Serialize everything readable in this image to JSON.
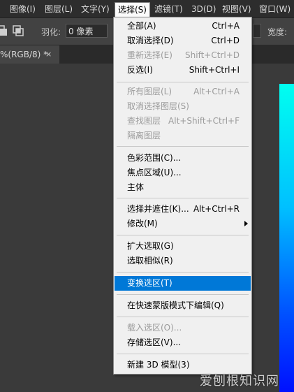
{
  "menubar": {
    "items": [
      "图像(I)",
      "图层(L)",
      "文字(Y)",
      "选择(S)",
      "滤镜(T)",
      "3D(D)",
      "视图(V)",
      "窗口(W)"
    ]
  },
  "options": {
    "feather_label": "羽化:",
    "feather_value": "0 像素",
    "width_label": "宽度:"
  },
  "document_tab": {
    "title": "%(RGB/8) *",
    "close": "×"
  },
  "select_menu": {
    "items": [
      {
        "label": "全部(A)",
        "shortcut": "Ctrl+A",
        "enabled": true
      },
      {
        "label": "取消选择(D)",
        "shortcut": "Ctrl+D",
        "enabled": true
      },
      {
        "label": "重新选择(E)",
        "shortcut": "Shift+Ctrl+D",
        "enabled": false
      },
      {
        "label": "反选(I)",
        "shortcut": "Shift+Ctrl+I",
        "enabled": true
      },
      {
        "label": "所有图层(L)",
        "shortcut": "Alt+Ctrl+A",
        "enabled": false
      },
      {
        "label": "取消选择图层(S)",
        "shortcut": "",
        "enabled": false
      },
      {
        "label": "查找图层",
        "shortcut": "Alt+Shift+Ctrl+F",
        "enabled": false
      },
      {
        "label": "隔离图层",
        "shortcut": "",
        "enabled": false
      },
      {
        "label": "色彩范围(C)...",
        "shortcut": "",
        "enabled": true
      },
      {
        "label": "焦点区域(U)...",
        "shortcut": "",
        "enabled": true
      },
      {
        "label": "主体",
        "shortcut": "",
        "enabled": true
      },
      {
        "label": "选择并遮住(K)...",
        "shortcut": "Alt+Ctrl+R",
        "enabled": true
      },
      {
        "label": "修改(M)",
        "shortcut": "",
        "enabled": true,
        "submenu": true
      },
      {
        "label": "扩大选取(G)",
        "shortcut": "",
        "enabled": true
      },
      {
        "label": "选取相似(R)",
        "shortcut": "",
        "enabled": true
      },
      {
        "label": "变换选区(T)",
        "shortcut": "",
        "enabled": true,
        "highlighted": true
      },
      {
        "label": "在快速蒙版模式下编辑(Q)",
        "shortcut": "",
        "enabled": true
      },
      {
        "label": "载入选区(O)...",
        "shortcut": "",
        "enabled": false
      },
      {
        "label": "存储选区(V)...",
        "shortcut": "",
        "enabled": true
      },
      {
        "label": "新建 3D 模型(3)",
        "shortcut": "",
        "enabled": true
      }
    ]
  },
  "watermark": "爱刨根知识网",
  "colors": {
    "highlight": "#0078d7",
    "menu_bg": "#f0f0f0",
    "disabled_text": "#9b9b9b",
    "app_bg": "#3c3c3c"
  }
}
